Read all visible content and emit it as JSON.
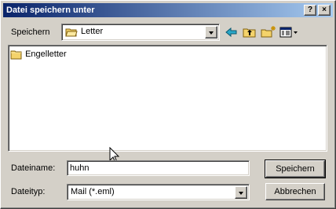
{
  "window": {
    "title": "Datei speichern unter",
    "help_label": "?",
    "close_label": "×"
  },
  "save_in": {
    "label": "Speichern",
    "folder": "Letter"
  },
  "file_list": {
    "items": [
      {
        "name": "Engelletter",
        "icon": "folder-icon"
      }
    ]
  },
  "filename": {
    "label": "Dateiname:",
    "value": "huhn"
  },
  "filetype": {
    "label": "Dateityp:",
    "value": "Mail (*.eml)"
  },
  "buttons": {
    "save": "Speichern",
    "cancel": "Abbrechen"
  },
  "toolbar_icons": [
    "back-arrow-icon",
    "up-folder-icon",
    "new-folder-icon",
    "view-menu-icon"
  ],
  "colors": {
    "titlebar_start": "#0a246a",
    "titlebar_end": "#a6caf0",
    "face": "#d4d0c8",
    "folder_yellow": "#f4d36b"
  }
}
